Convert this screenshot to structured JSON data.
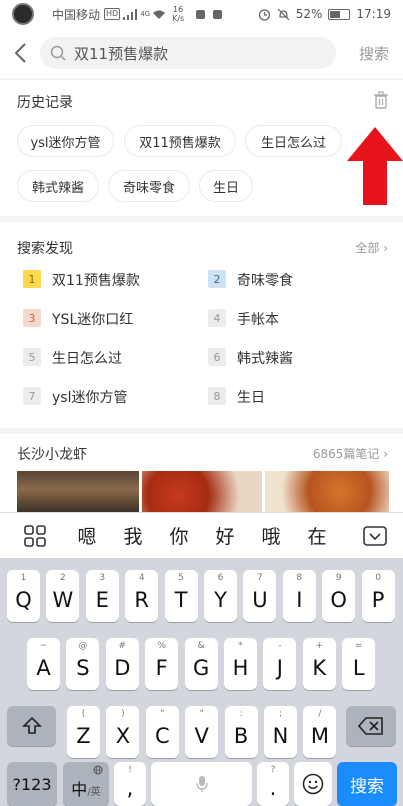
{
  "status": {
    "carrier": "中国移动",
    "hd": "HD",
    "net": "4G",
    "speed_value": "16",
    "speed_unit": "K/s",
    "battery": "52%",
    "battery_level": 0.52,
    "time": "17:19"
  },
  "search": {
    "query": "双11预售爆款",
    "button": "搜索"
  },
  "history": {
    "title": "历史记录",
    "tags": [
      "ysl迷你方管",
      "双11预售爆款",
      "生日怎么过",
      "韩式辣酱",
      "奇味零食",
      "生日"
    ]
  },
  "discover": {
    "title": "搜索发现",
    "more": "全部",
    "items": [
      {
        "rank": "1",
        "text": "双11预售爆款"
      },
      {
        "rank": "2",
        "text": "奇味零食"
      },
      {
        "rank": "3",
        "text": "YSL迷你口红"
      },
      {
        "rank": "4",
        "text": "手帐本"
      },
      {
        "rank": "5",
        "text": "生日怎么过"
      },
      {
        "rank": "6",
        "text": "韩式辣酱"
      },
      {
        "rank": "7",
        "text": "ysl迷你方管"
      },
      {
        "rank": "8",
        "text": "生日"
      }
    ]
  },
  "notes": {
    "title": "长沙小龙虾",
    "count": "6865篇笔记"
  },
  "keyboard": {
    "candidates": [
      "嗯",
      "我",
      "你",
      "好",
      "哦",
      "在"
    ],
    "row1": [
      {
        "sub": "1",
        "key": "Q"
      },
      {
        "sub": "2",
        "key": "W"
      },
      {
        "sub": "3",
        "key": "E"
      },
      {
        "sub": "4",
        "key": "R"
      },
      {
        "sub": "5",
        "key": "T"
      },
      {
        "sub": "6",
        "key": "Y"
      },
      {
        "sub": "7",
        "key": "U"
      },
      {
        "sub": "8",
        "key": "I"
      },
      {
        "sub": "9",
        "key": "O"
      },
      {
        "sub": "0",
        "key": "P"
      }
    ],
    "row2": [
      {
        "sub": "~",
        "key": "A"
      },
      {
        "sub": "@",
        "key": "S"
      },
      {
        "sub": "#",
        "key": "D"
      },
      {
        "sub": "%",
        "key": "F"
      },
      {
        "sub": "&",
        "key": "G"
      },
      {
        "sub": "*",
        "key": "H"
      },
      {
        "sub": "-",
        "key": "J"
      },
      {
        "sub": "+",
        "key": "K"
      },
      {
        "sub": "=",
        "key": "L"
      }
    ],
    "row3": [
      {
        "sub": "(",
        "key": "Z"
      },
      {
        "sub": ")",
        "key": "X"
      },
      {
        "sub": "\"",
        "key": "C"
      },
      {
        "sub": "\"",
        "key": "V"
      },
      {
        "sub": ":",
        "key": "B"
      },
      {
        "sub": ";",
        "key": "N"
      },
      {
        "sub": "/",
        "key": "M"
      }
    ],
    "symbols": "?123",
    "lang_main": "中",
    "lang_sub": "/英",
    "comma": ",",
    "comma_sub": "!",
    "period": ".",
    "period_sub": "?",
    "search": "搜索"
  },
  "colors": {
    "arrow": "#e8141b",
    "rank1": "#ffd84d",
    "rank2": "#cfe2f3",
    "rank3": "#f6d9cc",
    "search_key": "#1a8cff"
  }
}
